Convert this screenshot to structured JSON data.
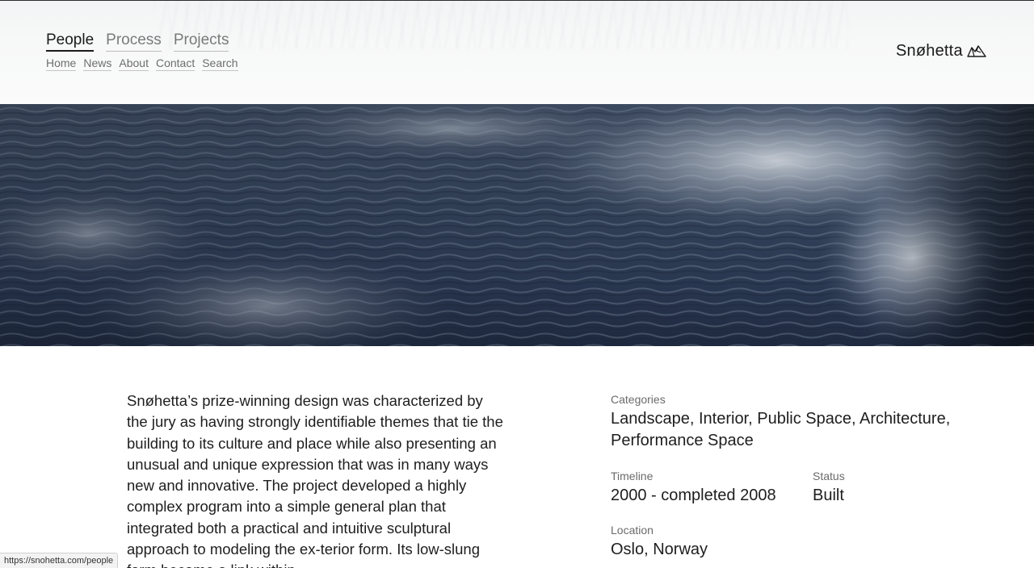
{
  "nav": {
    "primary": [
      {
        "label": "People",
        "active": true
      },
      {
        "label": "Process",
        "active": false
      },
      {
        "label": "Projects",
        "active": false
      }
    ],
    "secondary": [
      "Home",
      "News",
      "About",
      "Contact",
      "Search"
    ]
  },
  "brand": {
    "name": "Snøhetta",
    "icon": "mountain-logo-icon"
  },
  "project": {
    "description": "Snøhetta’s prize-winning design was characterized by the jury as having strongly identifiable themes that tie the building to its culture and place while also presenting an unusual and unique expression that was in many ways new and innovative. The project developed a highly complex program into a simple general plan that integrated both a practical and intuitive sculptural approach to modeling the ex-terior form. Its low-slung form became a link within",
    "meta": {
      "categories_label": "Categories",
      "categories_value": "Landscape, Interior, Public Space, Architecture, Performance Space",
      "timeline_label": "Timeline",
      "timeline_value": "2000 - completed 2008",
      "status_label": "Status",
      "status_value": "Built",
      "location_label": "Location",
      "location_value": "Oslo, Norway"
    }
  },
  "status_bar": {
    "url": "https://snohetta.com/people"
  },
  "colors": {
    "text": "#1a1a1a",
    "muted": "#7a7a7a",
    "water_dark": "#1f2a40",
    "water_light": "#c9d0da"
  }
}
